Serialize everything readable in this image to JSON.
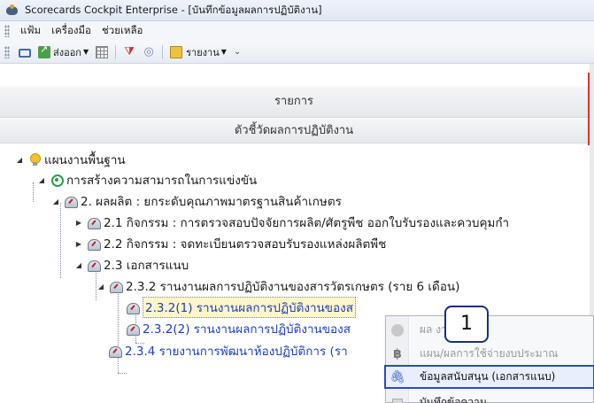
{
  "window": {
    "title": "Scorecards Cockpit Enterprise - [บันทึกข้อมูลผลการปฏิบัติงาน]"
  },
  "menu": [
    "แฟ้ม",
    "เครื่องมือ",
    "ช่วยเหลือ"
  ],
  "toolbar": {
    "export_label": "ส่งออก",
    "report_label": "รายงาน"
  },
  "grid": {
    "header_items": "รายการ",
    "header_kpi": "ตัวชี้วัดผลการปฏิบัติงาน"
  },
  "tree": [
    {
      "text": "แผนงานพื้นฐาน",
      "icon": "bulb-icon"
    },
    {
      "text": "การสร้างความสามารถในการแข่งขัน",
      "icon": "target-icon"
    },
    {
      "text": "2. ผลผลิต : ยกระดับคุณภาพมาตรฐานสินค้าเกษตร",
      "icon": "gauge-icon"
    },
    {
      "text": "2.1 กิจกรรม : การตรวจสอบปัจจัยการผลิต/ศัตรูพืช ออกใบรับรองและควบคุมกำ",
      "icon": "gauge-icon"
    },
    {
      "text": "2.2 กิจกรรม : จดทะเบียนตรวจสอบรับรองแหล่งผลิตพืช",
      "icon": "gauge-icon"
    },
    {
      "text": "2.3 เอกสารแนบ",
      "icon": "gauge-icon"
    },
    {
      "text": "2.3.2 รานงานผลการปฏิบัติงานของสารวัตรเกษตร (ราย 6 เดือน)",
      "icon": "gauge-icon"
    },
    {
      "text": "2.3.2(1) รานงานผลการปฏิบัติงานของส",
      "icon": "gauge-icon"
    },
    {
      "text": "2.3.2(2) รานงานผลการปฏิบัติงานของส",
      "icon": "gauge-icon"
    },
    {
      "text": "2.3.4 รายงานการพัฒนาห้องปฏิบัติการ (รา",
      "icon": "gauge-icon"
    }
  ],
  "context_menu": [
    {
      "label": "ผล          งาน",
      "icon": "mask-icon"
    },
    {
      "label": "แผน/ผลการใช้จ่ายงบประมาณ",
      "icon": "baht-icon"
    },
    {
      "label": "ข้อมูลสนับสนุน (เอกสารแนบ)",
      "icon": "paperclip-icon"
    },
    {
      "label": "บันทึกข้อความ",
      "icon": "note-icon"
    }
  ],
  "callout": {
    "number": "1"
  },
  "colors": {
    "highlight_border": "#2c49c6",
    "link_blue": "#1a3fc8",
    "red_marker": "#e03030"
  }
}
